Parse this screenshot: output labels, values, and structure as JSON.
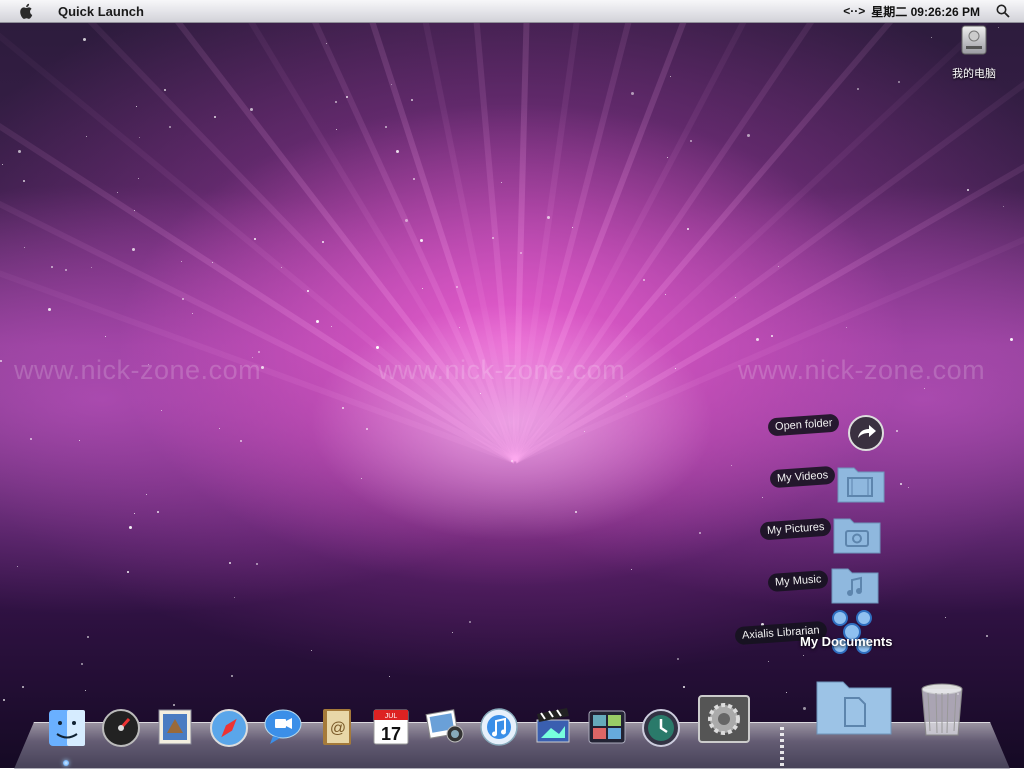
{
  "menubar": {
    "app_title": "Quick Launch",
    "network_icon": "<··>",
    "clock": "星期二 09:26:26 PM"
  },
  "desktop": {
    "computer_label": "我的电脑",
    "watermark": "www.nick-zone.com"
  },
  "stack": {
    "items": [
      {
        "label": "Open folder",
        "icon": "arrow-icon"
      },
      {
        "label": "My Videos",
        "icon": "video-folder-icon"
      },
      {
        "label": "My Pictures",
        "icon": "pictures-folder-icon"
      },
      {
        "label": "My Music",
        "icon": "music-folder-icon"
      },
      {
        "label": "Axialis Librarian",
        "icon": "librarian-icon"
      }
    ],
    "title": "My Documents"
  },
  "dock": {
    "items": [
      "finder-icon",
      "dashboard-icon",
      "mail-icon",
      "safari-icon",
      "ichat-icon",
      "address-book-icon",
      "ical-icon",
      "iphoto-icon",
      "itunes-icon",
      "imovie-icon",
      "spaces-icon",
      "time-machine-icon",
      "system-preferences-icon",
      "documents-folder-icon",
      "trash-icon"
    ],
    "ical_day": "17",
    "ical_month": "JUL"
  },
  "colors": {
    "accent": "#e46ee0",
    "menubar": "#e3e3e8"
  }
}
